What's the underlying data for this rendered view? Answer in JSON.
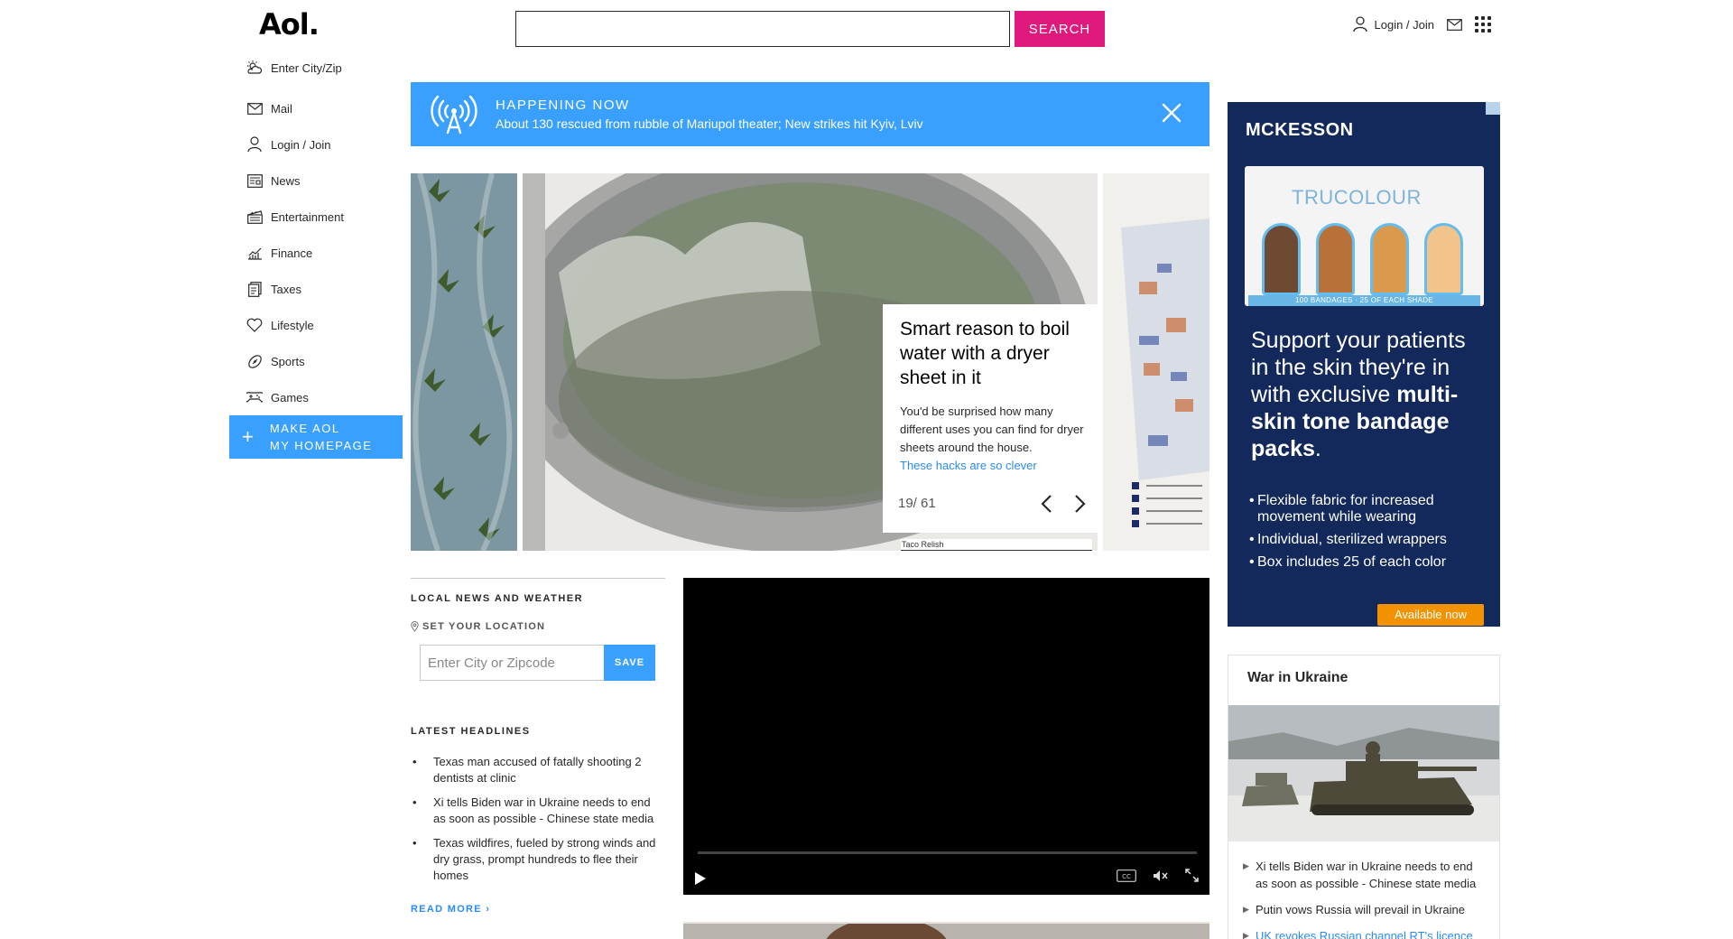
{
  "header": {
    "logo": "Aol.",
    "search_placeholder": "",
    "search_button": "SEARCH",
    "login_label": "Login / Join"
  },
  "leftnav": {
    "items": [
      {
        "label": "Enter City/Zip",
        "icon": "weather-icon"
      },
      {
        "label": "Mail",
        "icon": "mail-icon"
      },
      {
        "label": "Login / Join",
        "icon": "user-icon"
      },
      {
        "label": "News",
        "icon": "news-icon"
      },
      {
        "label": "Entertainment",
        "icon": "clapper-icon"
      },
      {
        "label": "Finance",
        "icon": "finance-icon"
      },
      {
        "label": "Taxes",
        "icon": "taxes-icon"
      },
      {
        "label": "Lifestyle",
        "icon": "heart-icon"
      },
      {
        "label": "Sports",
        "icon": "football-icon"
      },
      {
        "label": "Games",
        "icon": "gamepad-icon"
      }
    ],
    "homepage_line1": "MAKE AOL",
    "homepage_line2": "MY HOMEPAGE"
  },
  "banner": {
    "heading": "HAPPENING NOW",
    "text": "About 130 rescued from rubble of Mariupol theater; New strikes hit Kyiv, Lviv"
  },
  "carousel": {
    "title": "Smart reason to boil water with a dryer sheet in it",
    "description": "You'd be surprised how many different uses you can find for dryer sheets around the house.",
    "link": "These hacks are so clever",
    "counter": "19/ 61",
    "strip_text": "Taco Relish"
  },
  "local": {
    "title": "LOCAL NEWS AND WEATHER",
    "set_location": "SET YOUR LOCATION",
    "input_placeholder": "Enter City or Zipcode",
    "save": "SAVE",
    "headlines_title": "LATEST HEADLINES",
    "headlines": [
      "Texas man accused of fatally shooting 2 dentists at clinic",
      "Xi tells Biden war in Ukraine needs to end as soon as possible - Chinese state media",
      "Texas wildfires, fueled by strong winds and dry grass, prompt hundreds to flee their homes"
    ],
    "read_more": "READ MORE ›"
  },
  "ad": {
    "brand": "MCKESSON",
    "product_logo": "TRUCOLOUR",
    "product_strip": "100 BANDAGES · 25 OF EACH SHADE",
    "tagline_normal": "Support your patients in the skin they're in with exclusive",
    "tagline_bold": "multi-skin tone bandage packs",
    "tagline_end": ".",
    "bullets": [
      "Flexible fabric for increased movement while wearing",
      "Individual, sterilized wrappers",
      "Box includes 25 of each color"
    ],
    "cta": "Available now",
    "colors": {
      "background": "#13295b",
      "cta": "#f39200"
    }
  },
  "war": {
    "title": "War in Ukraine",
    "items": [
      "Xi tells Biden war in Ukraine needs to end as soon as possible - Chinese state media",
      "Putin vows Russia will prevail in Ukraine",
      "UK revokes Russian channel RT's licence"
    ]
  },
  "colors": {
    "accent_blue": "#39a0ff",
    "search_pink": "#e0197d",
    "link_blue": "#2a8bf2"
  }
}
